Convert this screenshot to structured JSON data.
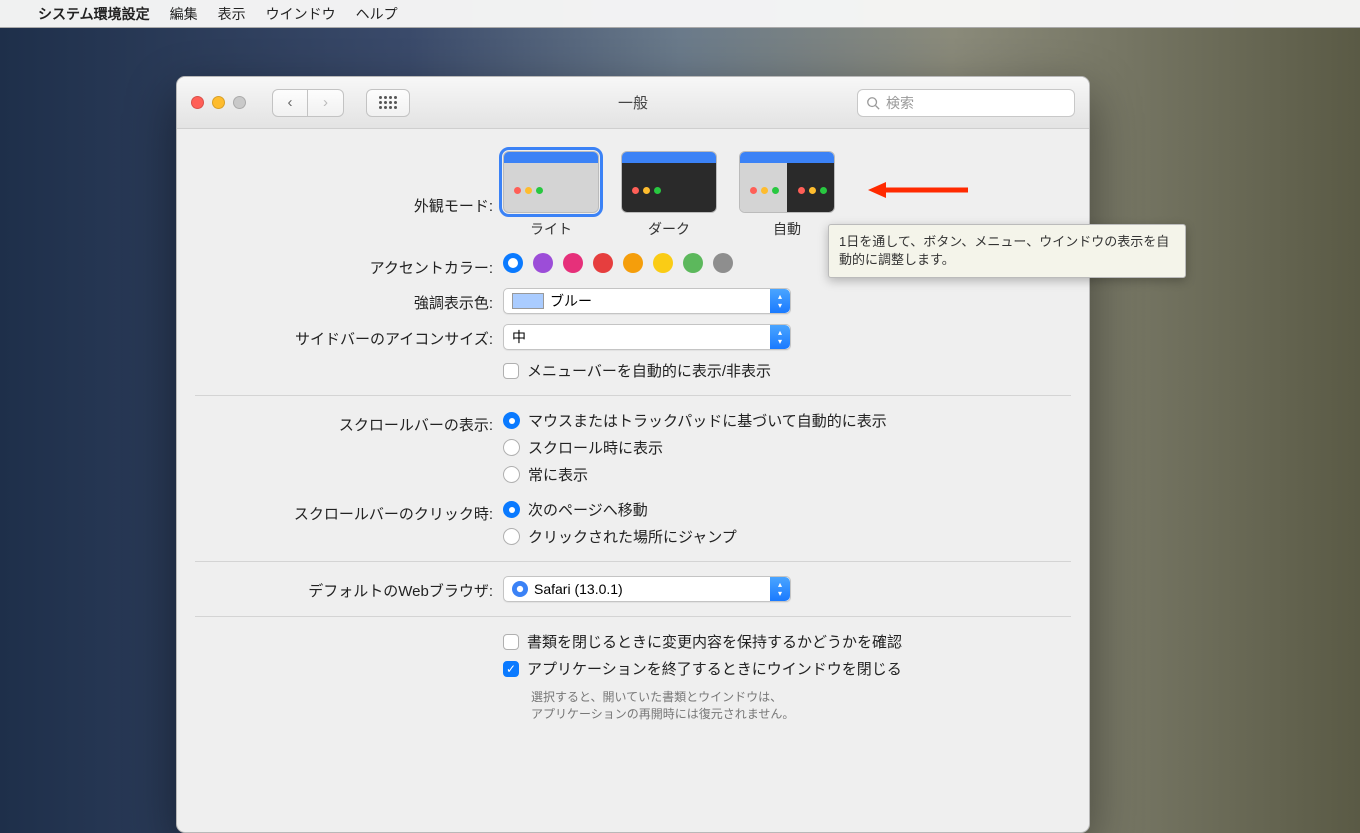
{
  "menubar": {
    "app_name": "システム環境設定",
    "items": [
      "編集",
      "表示",
      "ウインドウ",
      "ヘルプ"
    ]
  },
  "window": {
    "title": "一般",
    "search_placeholder": "検索"
  },
  "appearance": {
    "label": "外観モード:",
    "options": {
      "light": "ライト",
      "dark": "ダーク",
      "auto": "自動"
    }
  },
  "accent": {
    "label": "アクセントカラー:",
    "colors": [
      "#0a7aff",
      "#9c4dd8",
      "#e6307a",
      "#e63e3e",
      "#f59e0b",
      "#facc15",
      "#5cb85c",
      "#8e8e8e"
    ]
  },
  "highlight": {
    "label": "強調表示色:",
    "value": "ブルー"
  },
  "sidebar_icon": {
    "label": "サイドバーのアイコンサイズ:",
    "value": "中"
  },
  "auto_hide_menubar": "メニューバーを自動的に表示/非表示",
  "scrollbar_show": {
    "label": "スクロールバーの表示:",
    "options": {
      "auto": "マウスまたはトラックパッドに基づいて自動的に表示",
      "scrolling": "スクロール時に表示",
      "always": "常に表示"
    }
  },
  "scrollbar_click": {
    "label": "スクロールバーのクリック時:",
    "options": {
      "next_page": "次のページへ移動",
      "jump": "クリックされた場所にジャンプ"
    }
  },
  "browser": {
    "label": "デフォルトのWebブラウザ:",
    "value": "Safari (13.0.1)"
  },
  "docs": {
    "ask_save": "書類を閉じるときに変更内容を保持するかどうかを確認",
    "close_windows": "アプリケーションを終了するときにウインドウを閉じる",
    "hint1": "選択すると、開いていた書類とウインドウは、",
    "hint2": "アプリケーションの再開時には復元されません。"
  },
  "tooltip": "1日を通して、ボタン、メニュー、ウインドウの表示を自動的に調整します。"
}
